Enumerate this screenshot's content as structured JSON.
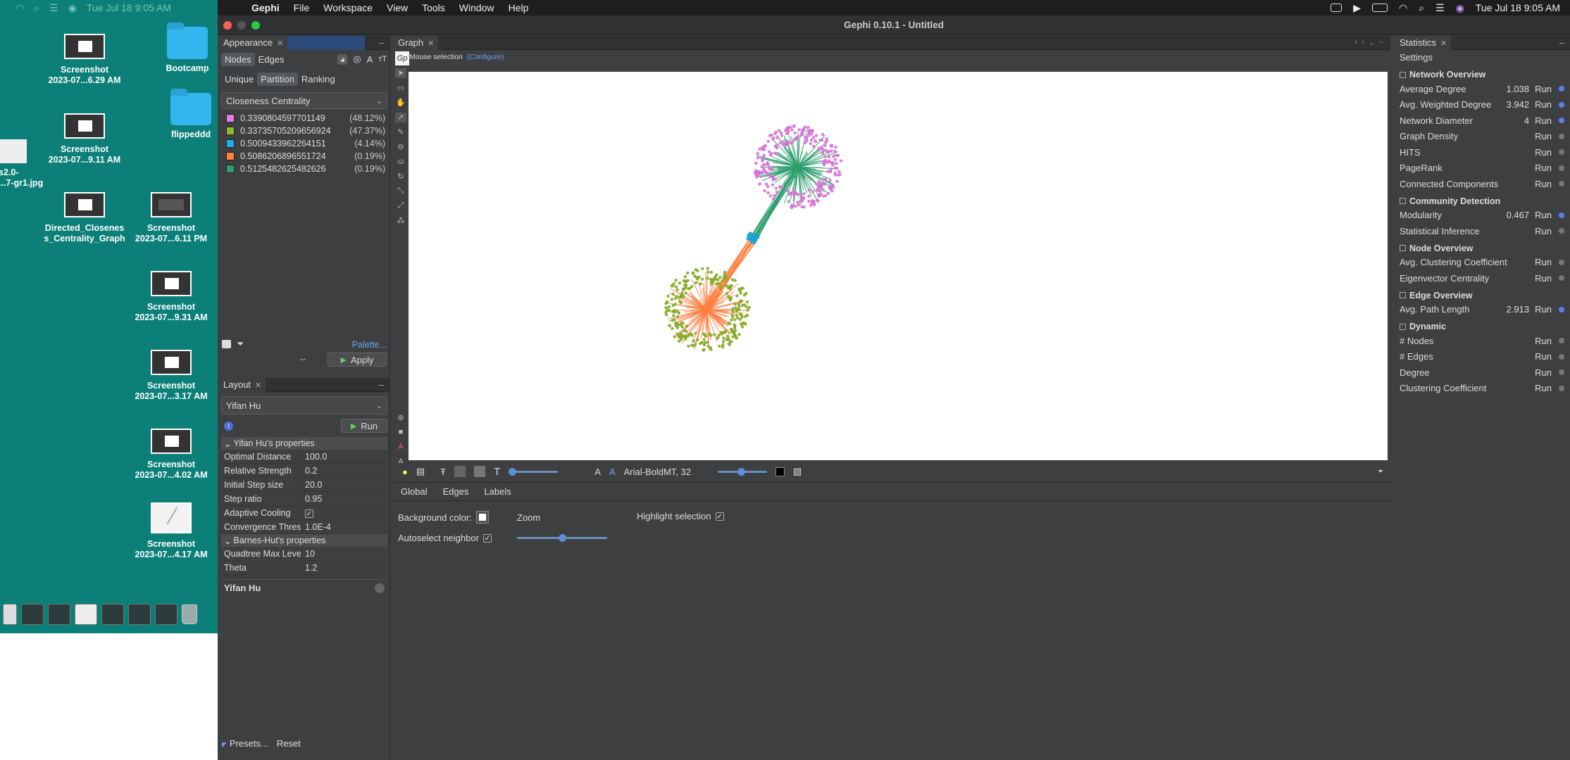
{
  "desktop": {
    "menubar_time": "Tue Jul 18  9:05 AM",
    "items": [
      {
        "line1": "Screenshot",
        "line2": "2023-07...6.29 AM"
      },
      {
        "line1": "Bootcamp",
        "line2": ""
      },
      {
        "line1": "Screenshot",
        "line2": "2023-07...9.11 AM"
      },
      {
        "line1": "flippeddd",
        "line2": ""
      },
      {
        "line1": "s2.0-",
        "line2": "...7-gr1.jpg"
      },
      {
        "line1": "Directed_Closenes",
        "line2": "s_Centrality_Graph"
      },
      {
        "line1": "Screenshot",
        "line2": "2023-07...6.11 PM"
      },
      {
        "line1": "Screenshot",
        "line2": "2023-07...9.31 AM"
      },
      {
        "line1": "Screenshot",
        "line2": "2023-07...3.17 AM"
      },
      {
        "line1": "Screenshot",
        "line2": "2023-07...4.02 AM"
      },
      {
        "line1": "Screenshot",
        "line2": "2023-07...4.17 AM"
      }
    ]
  },
  "menubar": {
    "app": "Gephi",
    "items": [
      "File",
      "Workspace",
      "View",
      "Tools",
      "Window",
      "Help"
    ],
    "clock": "Tue Jul 18  9:05 AM"
  },
  "window": {
    "title": "Gephi 0.10.1 - Untitled"
  },
  "appearance": {
    "tab": "Appearance",
    "element_tabs": [
      "Nodes",
      "Edges"
    ],
    "mode_tabs": [
      "Unique",
      "Partition",
      "Ranking"
    ],
    "attribute": "Closeness Centrality",
    "partitions": [
      {
        "value": "0.3390804597701149",
        "pct": "(48.12%)",
        "color": "#e67ce6"
      },
      {
        "value": "0.33735705209656924",
        "pct": "(47.37%)",
        "color": "#8fba2a"
      },
      {
        "value": "0.5009433962264151",
        "pct": "(4.14%)",
        "color": "#1ab2e6"
      },
      {
        "value": "0.5086206896551724",
        "pct": "(0.19%)",
        "color": "#ff7f3f"
      },
      {
        "value": "0.5125482625482626",
        "pct": "(0.19%)",
        "color": "#2e9e6e"
      }
    ],
    "palette_link": "Palette...",
    "dash": "--",
    "apply": "Apply"
  },
  "layout": {
    "tab": "Layout",
    "algorithm": "Yifan Hu",
    "run": "Run",
    "info_glyph": "i",
    "section1": "Yifan Hu's properties",
    "props1": [
      {
        "k": "Optimal Distance",
        "v": "100.0"
      },
      {
        "k": "Relative Strength",
        "v": "0.2"
      },
      {
        "k": "Initial Step size",
        "v": "20.0"
      },
      {
        "k": "Step ratio",
        "v": "0.95"
      },
      {
        "k": "Adaptive Cooling",
        "v": "✓"
      },
      {
        "k": "Convergence Thres",
        "v": "1.0E-4"
      }
    ],
    "section2": "Barnes-Hut's properties",
    "props2": [
      {
        "k": "Quadtree Max Leve",
        "v": "10"
      },
      {
        "k": "Theta",
        "v": "1.2"
      }
    ],
    "description_title": "Yifan Hu",
    "presets": "Presets...",
    "reset": "Reset"
  },
  "graph": {
    "tab": "Graph",
    "mouse_selection": "Mouse selection",
    "configure": "(Configure)",
    "font_label": "Arial-BoldMT, 32",
    "prop_tabs": [
      "Global",
      "Edges",
      "Labels"
    ],
    "background_color_label": "Background color:",
    "zoom_label": "Zoom",
    "highlight_selection_label": "Highlight selection",
    "autoselect_label": "Autoselect neighbor",
    "zoom_level": 0.5,
    "edge_scale_level": 0.4
  },
  "statistics": {
    "tab": "Statistics",
    "settings": "Settings",
    "sections": [
      {
        "title": "Network Overview",
        "rows": [
          {
            "name": "Average Degree",
            "value": "1.038",
            "info": true
          },
          {
            "name": "Avg. Weighted Degree",
            "value": "3.942",
            "info": true
          },
          {
            "name": "Network Diameter",
            "value": "4",
            "info": true
          },
          {
            "name": "Graph Density",
            "value": "",
            "info": false
          },
          {
            "name": "HITS",
            "value": "",
            "info": false
          },
          {
            "name": "PageRank",
            "value": "",
            "info": false
          },
          {
            "name": "Connected Components",
            "value": "",
            "info": false
          }
        ]
      },
      {
        "title": "Community Detection",
        "rows": [
          {
            "name": "Modularity",
            "value": "0.467",
            "info": true
          },
          {
            "name": "Statistical Inference",
            "value": "",
            "info": false
          }
        ]
      },
      {
        "title": "Node Overview",
        "rows": [
          {
            "name": "Avg. Clustering Coefficient",
            "value": "",
            "info": false
          },
          {
            "name": "Eigenvector Centrality",
            "value": "",
            "info": false
          }
        ]
      },
      {
        "title": "Edge Overview",
        "rows": [
          {
            "name": "Avg. Path Length",
            "value": "2.913",
            "info": true
          }
        ]
      },
      {
        "title": "Dynamic",
        "rows": [
          {
            "name": "# Nodes",
            "value": "",
            "info": false
          },
          {
            "name": "# Edges",
            "value": "",
            "info": false
          },
          {
            "name": "Degree",
            "value": "",
            "info": false
          },
          {
            "name": "Clustering Coefficient",
            "value": "",
            "info": false
          }
        ]
      }
    ],
    "run_label": "Run"
  },
  "colors": {
    "cluster_top_nodes": "#e67ce6",
    "cluster_top_edges": "#2e9e6e",
    "cluster_bottom_nodes": "#8fba2a",
    "cluster_bottom_edges": "#ff7f3f",
    "bridge_nodes": "#1ab2e6"
  }
}
